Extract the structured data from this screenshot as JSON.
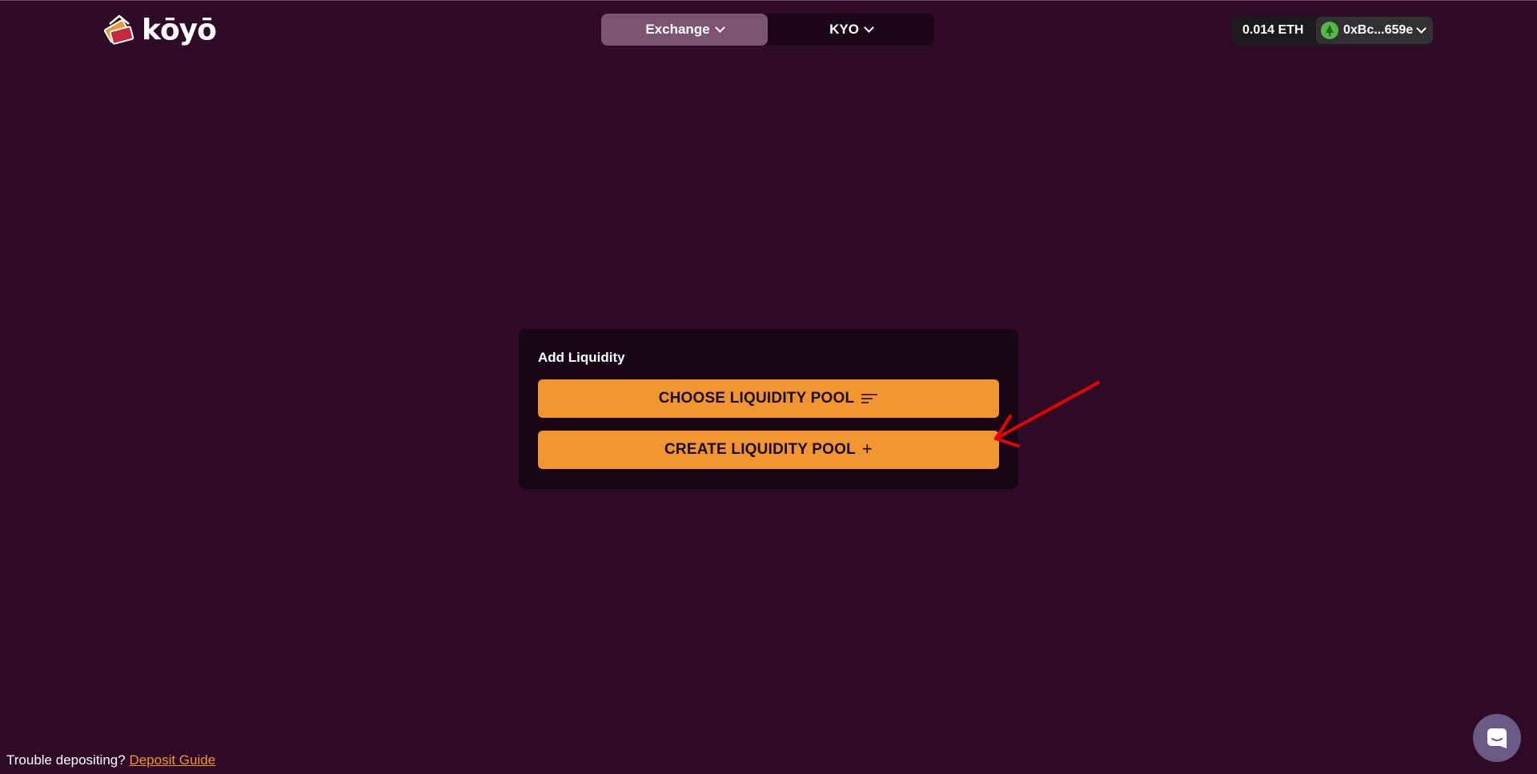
{
  "header": {
    "logo_text": "kōyō",
    "nav": [
      {
        "label": "Exchange",
        "active": true
      },
      {
        "label": "KYO",
        "active": false
      }
    ],
    "wallet": {
      "balance": "0.014 ETH",
      "address": "0xBc...659e"
    }
  },
  "card": {
    "title": "Add Liquidity",
    "choose_label": "CHOOSE LIQUIDITY POOL",
    "create_label": "CREATE LIQUIDITY POOL",
    "create_icon": "+"
  },
  "footer": {
    "help_text": "Trouble depositing?",
    "help_link": "Deposit Guide"
  },
  "colors": {
    "background": "#2e0a27",
    "accent": "#f0952f",
    "nav_active": "#7a5470",
    "annotation": "#e50000"
  }
}
